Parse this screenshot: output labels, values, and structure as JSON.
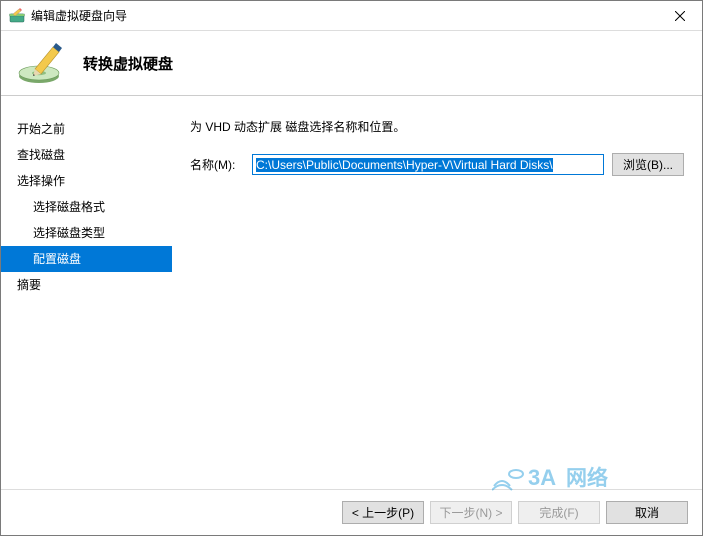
{
  "titlebar": {
    "title": "编辑虚拟硬盘向导"
  },
  "header": {
    "title": "转换虚拟硬盘"
  },
  "sidebar": {
    "items": [
      {
        "label": "开始之前",
        "sub": false,
        "sel": false
      },
      {
        "label": "查找磁盘",
        "sub": false,
        "sel": false
      },
      {
        "label": "选择操作",
        "sub": false,
        "sel": false
      },
      {
        "label": "选择磁盘格式",
        "sub": true,
        "sel": false
      },
      {
        "label": "选择磁盘类型",
        "sub": true,
        "sel": false
      },
      {
        "label": "配置磁盘",
        "sub": true,
        "sel": true
      },
      {
        "label": "摘要",
        "sub": false,
        "sel": false
      }
    ]
  },
  "content": {
    "prompt": "为 VHD 动态扩展 磁盘选择名称和位置。",
    "name_label": "名称(M):",
    "name_value": "C:\\Users\\Public\\Documents\\Hyper-V\\Virtual Hard Disks\\",
    "browse_label": "浏览(B)..."
  },
  "buttons": {
    "prev": "< 上一步(P)",
    "next": "下一步(N) >",
    "finish": "完成(F)",
    "cancel": "取消"
  },
  "watermark": {
    "text": "3A网络"
  }
}
